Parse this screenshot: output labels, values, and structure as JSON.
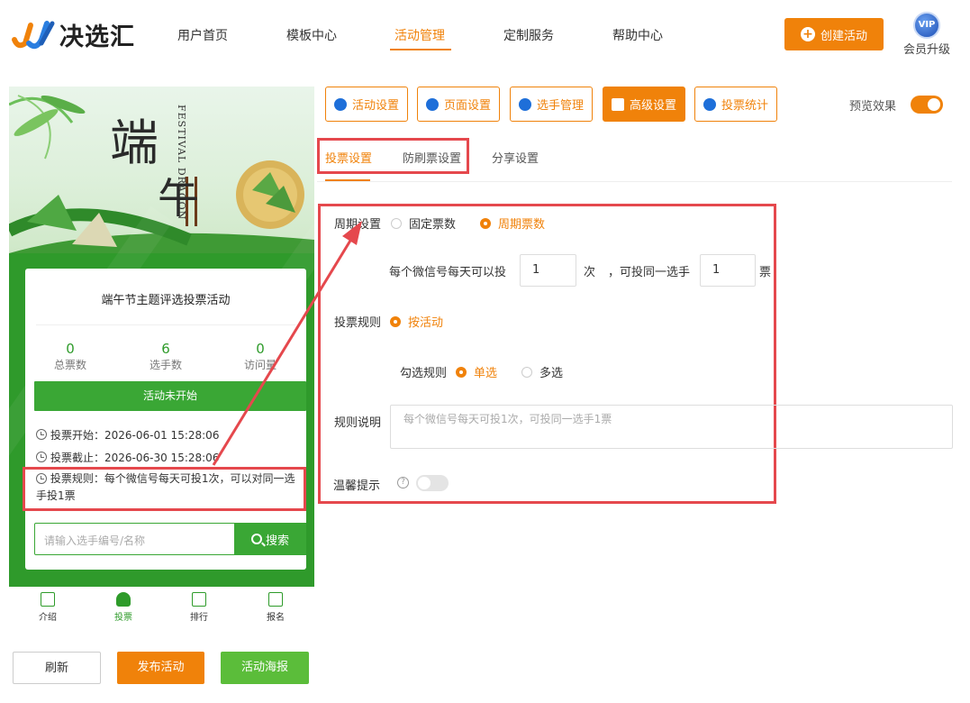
{
  "header": {
    "logo_text": "决选汇",
    "nav": [
      "用户首页",
      "模板中心",
      "活动管理",
      "定制服务",
      "帮助中心"
    ],
    "nav_active": "活动管理",
    "create_button": "创建活动",
    "vip_badge": "VIP",
    "vip_label": "会员升级"
  },
  "preview": {
    "banner_char1": "端",
    "banner_char2": "午",
    "banner_fest": "FESTIVAL DRAGON",
    "card_title": "端午节主题评选投票活动",
    "stats": [
      {
        "num": "0",
        "label": "总票数"
      },
      {
        "num": "6",
        "label": "选手数"
      },
      {
        "num": "0",
        "label": "访问量"
      }
    ],
    "status_button": "活动未开始",
    "vote_start": "投票开始：2026-06-01 15:28:06",
    "vote_end": "投票截止：2026-06-30 15:28:06",
    "vote_rule": "投票规则：每个微信号每天可投1次，可以对同一选手投1票",
    "search_placeholder": "请输入选手编号/名称",
    "search_button": "搜索",
    "tabbar": [
      "介绍",
      "投票",
      "排行",
      "报名"
    ],
    "tabbar_active": "投票"
  },
  "actions": {
    "refresh": "刷新",
    "publish": "发布活动",
    "poster": "活动海报"
  },
  "settings": {
    "top_tabs": [
      "活动设置",
      "页面设置",
      "选手管理",
      "高级设置",
      "投票统计"
    ],
    "top_tab_active": "高级设置",
    "preview_label": "预览效果",
    "preview_enabled": true,
    "sub_tabs": [
      "投票设置",
      "防刷票设置",
      "分享设置"
    ],
    "sub_tab_active": "投票设置",
    "period_label": "周期设置",
    "period_options": [
      "固定票数",
      "周期票数"
    ],
    "period_selected": "周期票数",
    "per_day_text": "每个微信号每天可以投",
    "per_day_value": "1",
    "times_unit": "次",
    "same_player_text": "，可投同一选手",
    "same_player_value": "1",
    "votes_unit": "票",
    "rule_label": "投票规则",
    "rule_option": "按活动",
    "select_rule_label": "勾选规则",
    "select_options": [
      "单选",
      "多选"
    ],
    "select_selected": "单选",
    "rule_desc_label": "规则说明",
    "rule_desc_placeholder": "每个微信号每天可投1次，可投同一选手1票",
    "tip_label": "温馨提示",
    "tip_help": "?",
    "tip_enabled": false
  },
  "colors": {
    "accent": "#f0820a",
    "green": "#2e9b2a",
    "highlight": "#e5484d"
  }
}
